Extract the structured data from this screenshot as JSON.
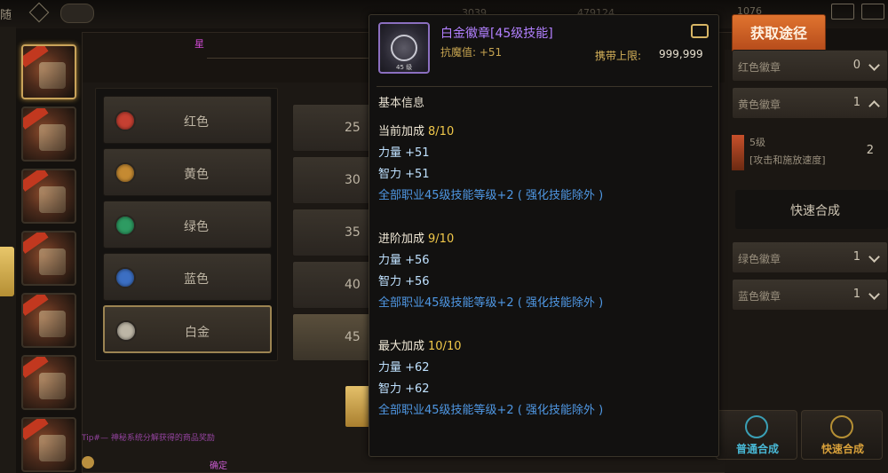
{
  "top_bar": {
    "left_label": "随",
    "num_1": "3039",
    "num_2": "479124",
    "num_3": "1076"
  },
  "main": {
    "pink_tag": "星",
    "colors": [
      {
        "label": "红色",
        "dot": "#c64032"
      },
      {
        "label": "黄色",
        "dot": "#c58a32"
      },
      {
        "label": "绿色",
        "dot": "#2e9b62"
      },
      {
        "label": "蓝色",
        "dot": "#3c6fc3"
      },
      {
        "label": "白金",
        "dot": "#bdb6a6"
      }
    ],
    "values": [
      "25",
      "30",
      "35",
      "40",
      "45"
    ],
    "chat_line": "Tip#— 神秘系统分解获得的商品奖励",
    "chat_line_2": "确定"
  },
  "right_panel": {
    "get_button": "获取途径",
    "rows": [
      {
        "label": "红色徽章",
        "count": "0"
      },
      {
        "label": "黄色徽章",
        "count": "1"
      },
      {
        "label": "绿色徽章",
        "count": "1"
      },
      {
        "label": "蓝色徽章",
        "count": "1"
      }
    ],
    "item_name": "5级",
    "item_desc": "[攻击和施放速度]",
    "item_count": "2",
    "quick_label": "快速合成",
    "btn_normal": "普通合成",
    "btn_quick": "快速合成"
  },
  "tooltip": {
    "title": "白金徽章[45级技能]",
    "sub": "抗魔值: +51",
    "icon_level": "45 级",
    "carry_label": "携带上限:",
    "carry_value": "999,999",
    "section": "基本信息",
    "groups": [
      {
        "head": "当前加成",
        "level": "8/10",
        "lines": [
          "力量 +51",
          "智力 +51"
        ],
        "skill": "全部职业45级技能等级+2 ( 强化技能除外 )"
      },
      {
        "head": "进阶加成",
        "level": "9/10",
        "lines": [
          "力量 +56",
          "智力 +56"
        ],
        "skill": "全部职业45级技能等级+2 ( 强化技能除外 )"
      },
      {
        "head": "最大加成",
        "level": "10/10",
        "lines": [
          "力量 +62",
          "智力 +62"
        ],
        "skill": "全部职业45级技能等级+2 ( 强化技能除外 )"
      }
    ]
  },
  "colors": {
    "title_purple": "#b280ff",
    "gold": "#f1c84a",
    "skill_blue": "#4f98e4",
    "stat_light_blue": "#bfe1ff",
    "orange_button": "#d0652a"
  }
}
